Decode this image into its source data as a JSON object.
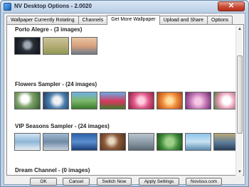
{
  "window": {
    "title": "NV Desktop Options - 2.0020",
    "close_glyph": "✕"
  },
  "tabs": [
    {
      "label": "Wallpaper Currently Rotating",
      "active": false
    },
    {
      "label": "Channels",
      "active": false
    },
    {
      "label": "Get More Wallpaper",
      "active": true
    },
    {
      "label": "Upload and Share",
      "active": false
    },
    {
      "label": "Options",
      "active": false
    }
  ],
  "groups": [
    {
      "title": "Porto Alegre - (3 images)",
      "thumbs": 3
    },
    {
      "title": "Flowers Sampler - (24 images)",
      "thumbs": 8
    },
    {
      "title": "VIP Seasons Sampler - (24 images)",
      "thumbs": 8
    },
    {
      "title": "Dream Channel - (0 images)",
      "thumbs": 0
    }
  ],
  "scrollbar": {
    "up_glyph": "▲",
    "down_glyph": "▼"
  },
  "buttons": {
    "ok": "OK",
    "cancel": "Cancel",
    "switch_now": "Switch Now",
    "apply_settings": "Apply Settings",
    "novisso": "Novisso.com"
  }
}
